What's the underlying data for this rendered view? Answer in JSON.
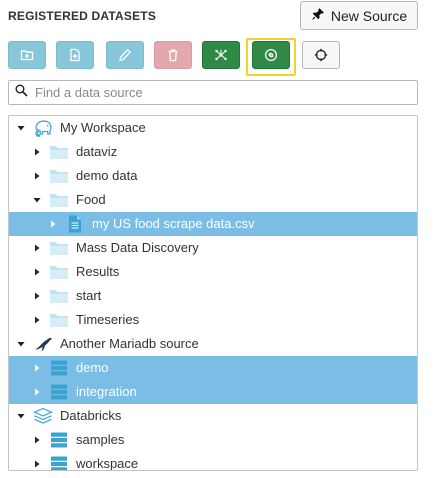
{
  "header": {
    "title": "REGISTERED DATASETS",
    "new_source_label": "New Source",
    "new_source_icon": "plug-icon"
  },
  "toolbar": {
    "buttons": [
      {
        "name": "new-folder-button",
        "icon": "folder-plus-icon",
        "color": "#88c6da"
      },
      {
        "name": "new-file-button",
        "icon": "file-plus-icon",
        "color": "#88c6da"
      },
      {
        "name": "edit-button",
        "icon": "pencil-icon",
        "color": "#88c6da"
      },
      {
        "name": "delete-button",
        "icon": "trash-icon",
        "color": "#e2a8ab"
      },
      {
        "name": "network-button",
        "icon": "network-icon",
        "color": "#2f8a48"
      },
      {
        "name": "connect-data-button",
        "icon": "connect-icon",
        "color": "#2f8a48"
      },
      {
        "name": "locate-button",
        "icon": "crosshair-icon",
        "color": "#f7f7f7"
      }
    ],
    "highlight_color": "#f3d22a"
  },
  "search": {
    "placeholder": "Find a data source",
    "value": ""
  },
  "tree": {
    "items": [
      {
        "label": "My Workspace",
        "icon": "elephant-icon",
        "expanded": true,
        "selected": false
      },
      {
        "label": "dataviz",
        "icon": "folder-icon",
        "expanded": false,
        "selected": false
      },
      {
        "label": "demo data",
        "icon": "folder-icon",
        "expanded": false,
        "selected": false
      },
      {
        "label": "Food",
        "icon": "folder-icon",
        "expanded": true,
        "selected": false
      },
      {
        "label": "my US food scrape data.csv",
        "icon": "file-icon",
        "expanded": false,
        "selected": true
      },
      {
        "label": "Mass Data Discovery",
        "icon": "folder-icon",
        "expanded": false,
        "selected": false
      },
      {
        "label": "Results",
        "icon": "folder-icon",
        "expanded": false,
        "selected": false
      },
      {
        "label": "start",
        "icon": "folder-icon",
        "expanded": false,
        "selected": false
      },
      {
        "label": "Timeseries",
        "icon": "folder-icon",
        "expanded": false,
        "selected": false
      },
      {
        "label": "Another Mariadb source",
        "icon": "mariadb-seal-icon",
        "expanded": true,
        "selected": false
      },
      {
        "label": "demo",
        "icon": "database-icon",
        "expanded": false,
        "selected": true
      },
      {
        "label": "integration",
        "icon": "database-icon",
        "expanded": false,
        "selected": true
      },
      {
        "label": "Databricks",
        "icon": "databricks-layers-icon",
        "expanded": true,
        "selected": false
      },
      {
        "label": "samples",
        "icon": "database-icon",
        "expanded": false,
        "selected": false
      },
      {
        "label": "workspace",
        "icon": "database-icon",
        "expanded": false,
        "selected": false
      }
    ],
    "selected_color": "#7cbde5",
    "icon_color": "#3aa3cf"
  }
}
